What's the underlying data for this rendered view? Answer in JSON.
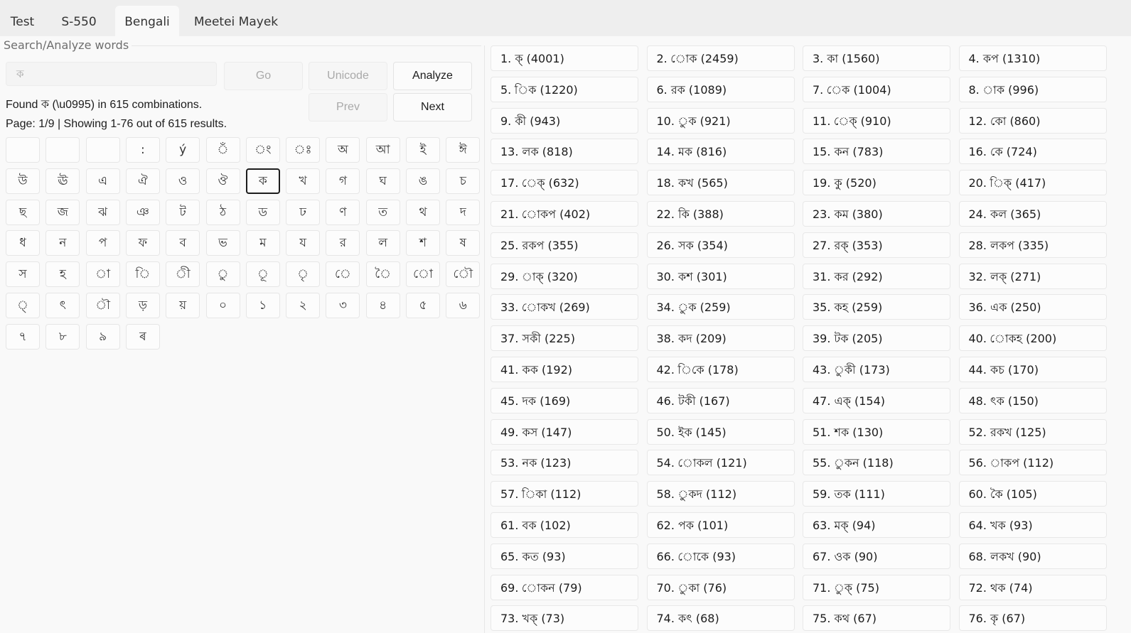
{
  "tabs": [
    "Test",
    "S-550",
    "Bengali",
    "Meetei Mayek"
  ],
  "active_tab": 2,
  "group_label": "Search/Analyze words",
  "search": {
    "value": "ক"
  },
  "buttons": {
    "go": "Go",
    "unicode": "Unicode",
    "analyze": "Analyze",
    "prev": "Prev",
    "next": "Next"
  },
  "found_text": "Found ক (\\u0995) in 615 combinations.",
  "page_text": "Page: 1/9 | Showing 1-76 out of 615 results.",
  "keys": [
    "",
    "",
    "",
    ":",
    "ý",
    "ঁ",
    "ং",
    "ঃ",
    "অ",
    "আ",
    "ই",
    "ঈ",
    "উ",
    "ঊ",
    "এ",
    "ঐ",
    "ও",
    "ঔ",
    "ক",
    "খ",
    "গ",
    "ঘ",
    "ঙ",
    "চ",
    "ছ",
    "জ",
    "ঝ",
    "ঞ",
    "ট",
    "ঠ",
    "ড",
    "ঢ",
    "ণ",
    "ত",
    "থ",
    "দ",
    "ধ",
    "ন",
    "প",
    "ফ",
    "ব",
    "ভ",
    "ম",
    "য",
    "র",
    "ল",
    "শ",
    "ষ",
    "স",
    "হ",
    "া",
    "ি",
    "ী",
    "ু",
    "ূ",
    "ৃ",
    "ে",
    "ৈ",
    "ো",
    "ৌ",
    "্",
    "ৎ",
    "ৗ",
    "ড়",
    "য়",
    "০",
    "১",
    "২",
    "৩",
    "৪",
    "৫",
    "৬",
    "৭",
    "৮",
    "৯",
    "ৰ"
  ],
  "selected_key": 18,
  "results": [
    "1. ক্ (4001)",
    "2. োক (2459)",
    "3. কা (1560)",
    "4. কপ (1310)",
    "5. িক (1220)",
    "6. রক (1089)",
    "7. েক (1004)",
    "8. াক (996)",
    "9. কী (943)",
    "10. ুক (921)",
    "11. েক্ (910)",
    "12. কো (860)",
    "13. লক (818)",
    "14. মক (816)",
    "15. কন (783)",
    "16. কে (724)",
    "17. েক্ (632)",
    "18. কখ (565)",
    "19. কু (520)",
    "20. িক্ (417)",
    "21. োকপ (402)",
    "22. কি (388)",
    "23. কম (380)",
    "24. কল (365)",
    "25. রকপ (355)",
    "26. সক (354)",
    "27. রক্ (353)",
    "28. লকপ (335)",
    "29. াক্ (320)",
    "30. কশ (301)",
    "31. কর (292)",
    "32. লক্ (271)",
    "33. োকখ (269)",
    "34. ুক (259)",
    "35. কহ (259)",
    "36. এক (250)",
    "37. সকী (225)",
    "38. কদ (209)",
    "39. টক (205)",
    "40. োকহ (200)",
    "41. কক (192)",
    "42. িকে (178)",
    "43. ুকী (173)",
    "44. কচ (170)",
    "45. দক (169)",
    "46. টকী (167)",
    "47. এক্ (154)",
    "48. ৎক (150)",
    "49. কস (147)",
    "50. ইক (145)",
    "51. শক (130)",
    "52. রকখ (125)",
    "53. নক (123)",
    "54. োকল (121)",
    "55. ুকন (118)",
    "56. াকপ (112)",
    "57. িকা (112)",
    "58. ুকদ (112)",
    "59. তক (111)",
    "60. কৈ (105)",
    "61. বক (102)",
    "62. পক (101)",
    "63. মক্ (94)",
    "64. খক (93)",
    "65. কত (93)",
    "66. োকে (93)",
    "67. ওক (90)",
    "68. লকখ (90)",
    "69. োকন (79)",
    "70. ুকা (76)",
    "71. ুক্ (75)",
    "72. থক (74)",
    "73. খক্ (73)",
    "74. কৎ (68)",
    "75. কথ (67)",
    "76. কৃ (67)"
  ]
}
